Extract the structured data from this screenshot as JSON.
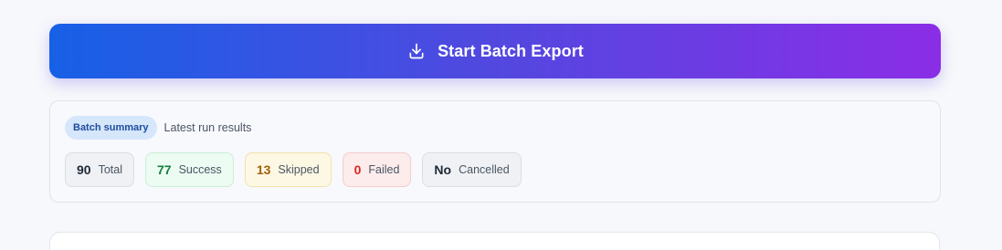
{
  "export_button": {
    "label": "Start Batch Export",
    "icon": "download-icon"
  },
  "summary": {
    "badge": "Batch summary",
    "subtitle": "Latest run results",
    "stats": [
      {
        "value": "90",
        "label": "Total",
        "color": "#1f2937"
      },
      {
        "value": "77",
        "label": "Success",
        "color": "#15803d"
      },
      {
        "value": "13",
        "label": "Skipped",
        "color": "#a16207"
      },
      {
        "value": "0",
        "label": "Failed",
        "color": "#dc2626"
      },
      {
        "value": "No",
        "label": "Cancelled",
        "color": "#1f2937"
      }
    ]
  },
  "colors": {
    "gradient_start": "#1760e6",
    "gradient_end": "#8b2de6",
    "badge_bg": "#d6e6fb"
  }
}
